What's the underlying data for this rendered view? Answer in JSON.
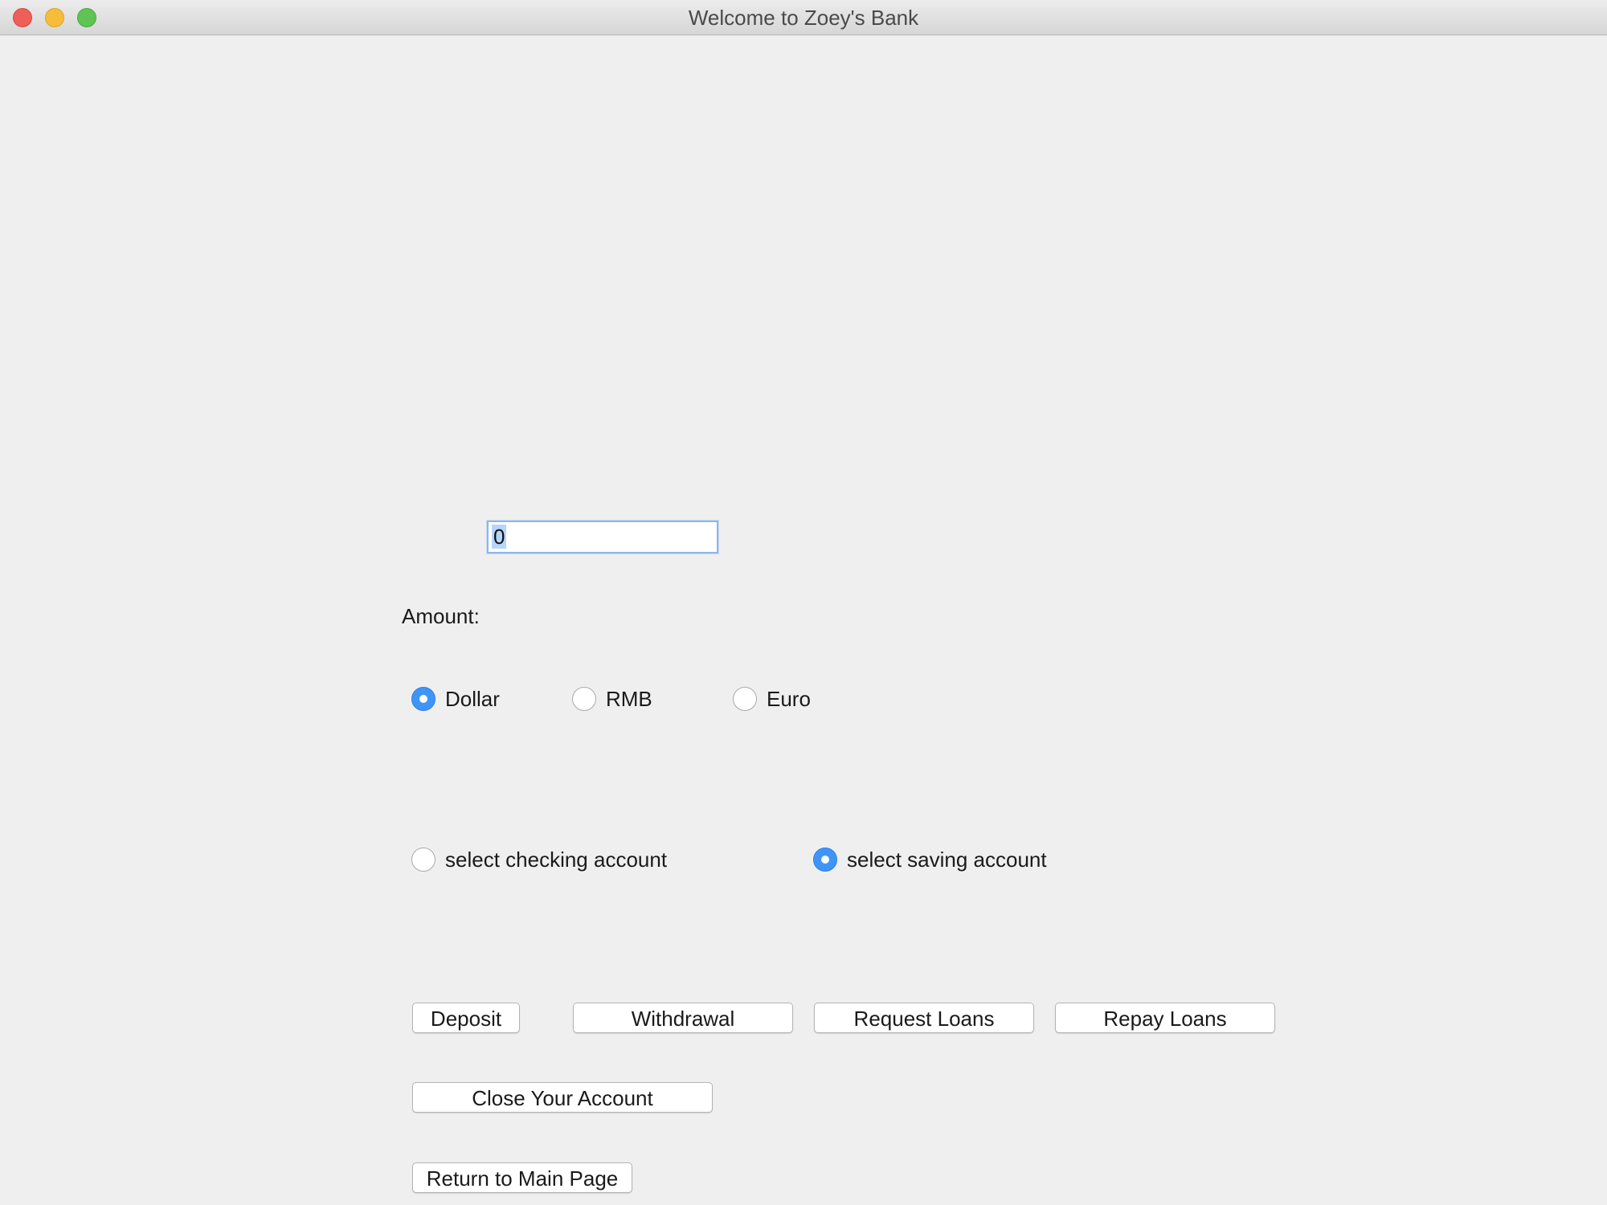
{
  "window": {
    "title": "Welcome to Zoey's Bank"
  },
  "amount": {
    "value": "0",
    "label": "Amount:"
  },
  "currency": {
    "options": [
      {
        "label": "Dollar",
        "selected": true
      },
      {
        "label": "RMB",
        "selected": false
      },
      {
        "label": "Euro",
        "selected": false
      }
    ]
  },
  "account": {
    "options": [
      {
        "label": "select checking account",
        "selected": false
      },
      {
        "label": "select saving account",
        "selected": true
      }
    ]
  },
  "buttons": {
    "deposit": "Deposit",
    "withdrawal": "Withdrawal",
    "request_loans": "Request Loans",
    "repay_loans": "Repay Loans",
    "close_account": "Close Your Account",
    "return_main": "Return to Main Page"
  },
  "colors": {
    "background": "#efefef",
    "radio_selected": "#3f95f7",
    "focus_ring": "#8fb5e6",
    "text_selection": "#b5d5fd"
  }
}
